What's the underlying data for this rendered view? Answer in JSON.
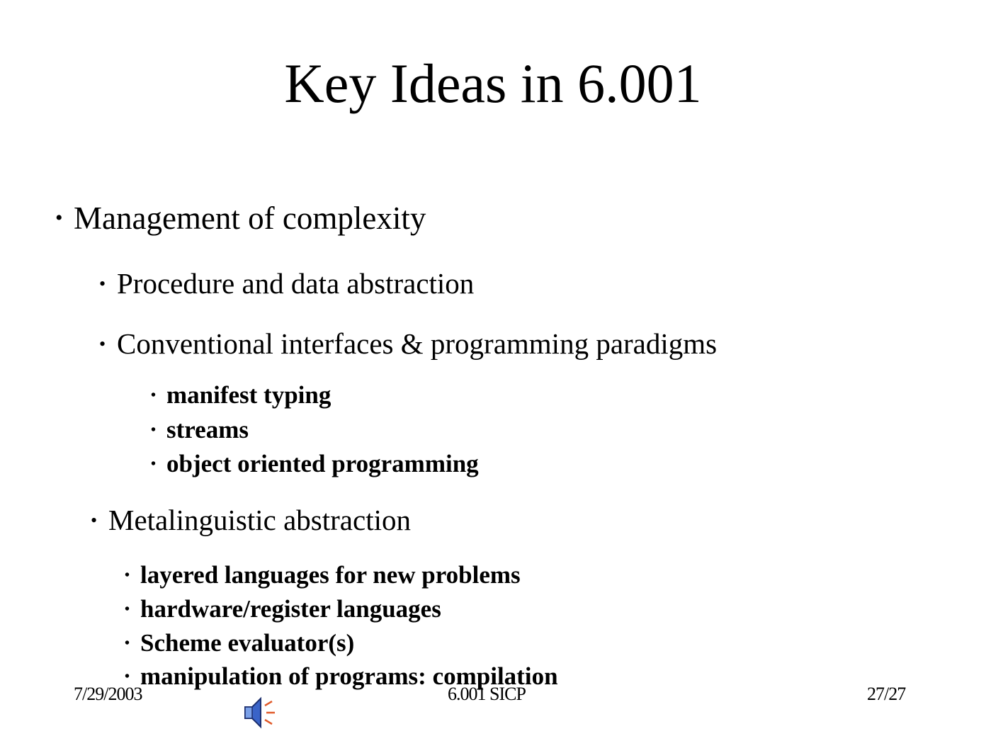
{
  "slide": {
    "title": "Key Ideas in 6.001",
    "bullets": [
      {
        "text": "Management of  complexity"
      },
      {
        "text": "Procedure and data abstraction"
      },
      {
        "text": "Conventional interfaces & programming paradigms"
      },
      {
        "text": "manifest typing"
      },
      {
        "text": "streams"
      },
      {
        "text": "object oriented programming"
      },
      {
        "text": "Metalinguistic abstraction"
      },
      {
        "text": "layered languages for new problems"
      },
      {
        "text": "hardware/register languages"
      },
      {
        "text": "Scheme evaluator(s)"
      },
      {
        "text": "manipulation of programs: compilation"
      }
    ],
    "bullet_glyph": "•"
  },
  "footer": {
    "date": "7/29/2003",
    "course": "6.001 SICP",
    "page": "27/27"
  },
  "icons": {
    "speaker": "speaker-icon"
  }
}
